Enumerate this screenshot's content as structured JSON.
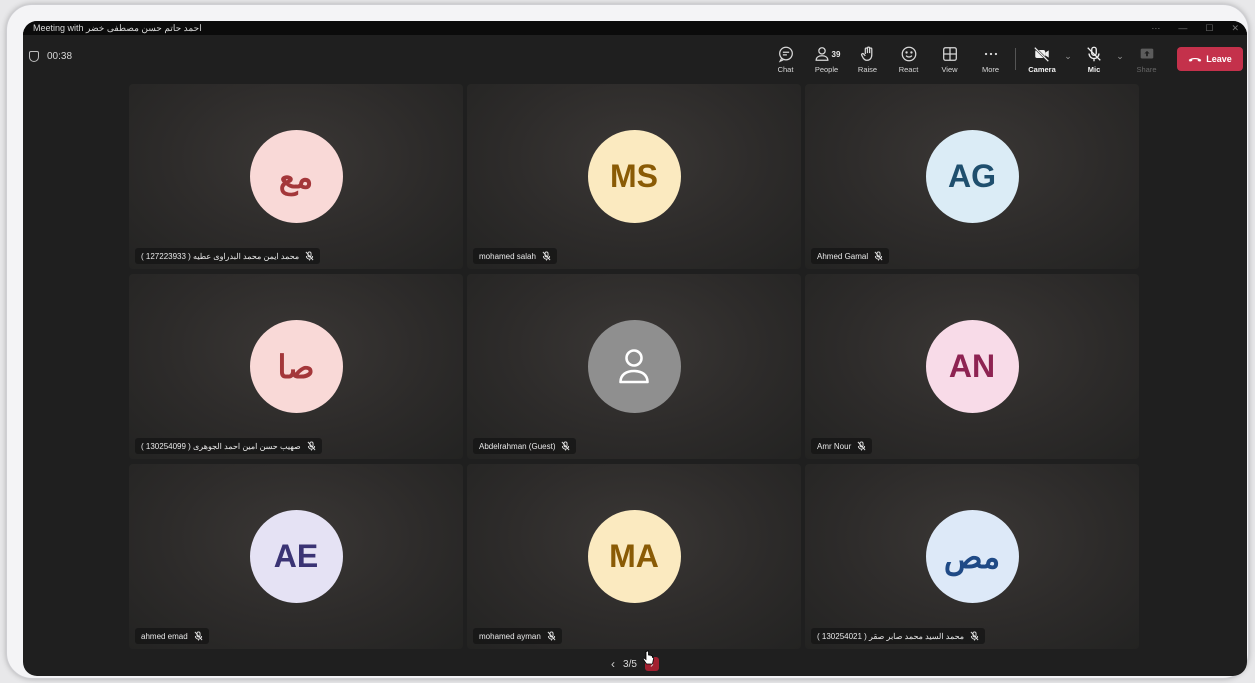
{
  "window": {
    "title": "Meeting with احمد حاتم حسن مصطفى خضر"
  },
  "meeting": {
    "timer": "00:38"
  },
  "toolbar": {
    "chat_label": "Chat",
    "people_label": "People",
    "people_count": "39",
    "raise_label": "Raise",
    "react_label": "React",
    "view_label": "View",
    "more_label": "More",
    "camera_label": "Camera",
    "mic_label": "Mic",
    "share_label": "Share",
    "leave_label": "Leave"
  },
  "participants": [
    {
      "initials": "مع",
      "name": "محمد ايمن محمد البدراوى عطيه ( 127223933 )",
      "avatar_bg": "#f9d9d7",
      "avatar_fg": "#a4373a"
    },
    {
      "initials": "MS",
      "name": "mohamed salah",
      "avatar_bg": "#fbeac0",
      "avatar_fg": "#8a5b05"
    },
    {
      "initials": "AG",
      "name": "Ahmed Gamal",
      "avatar_bg": "#dbecf6",
      "avatar_fg": "#1f4f6e"
    },
    {
      "initials": "صا",
      "name": "صهيب حسن امين احمد الجوهرى ( 130254099 )",
      "avatar_bg": "#f9d9d7",
      "avatar_fg": "#a4373a"
    },
    {
      "initials": "",
      "name": "Abdelrahman (Guest)",
      "avatar_bg": "#8f8f8f",
      "avatar_fg": "#ffffff"
    },
    {
      "initials": "AN",
      "name": "Amr Nour",
      "avatar_bg": "#f8dbe8",
      "avatar_fg": "#8e2352"
    },
    {
      "initials": "AE",
      "name": "ahmed emad",
      "avatar_bg": "#e5e2f4",
      "avatar_fg": "#3a3374"
    },
    {
      "initials": "MA",
      "name": "mohamed ayman",
      "avatar_bg": "#fbeac0",
      "avatar_fg": "#8a5b05"
    },
    {
      "initials": "مص",
      "name": "محمد السيد محمد صابر صقر ( 130254021 )",
      "avatar_bg": "#dde9f8",
      "avatar_fg": "#1f4a86"
    }
  ],
  "pager": {
    "label": "3/5"
  },
  "colors": {
    "leave": "#c4314b",
    "stage": "#1f1f1f"
  }
}
